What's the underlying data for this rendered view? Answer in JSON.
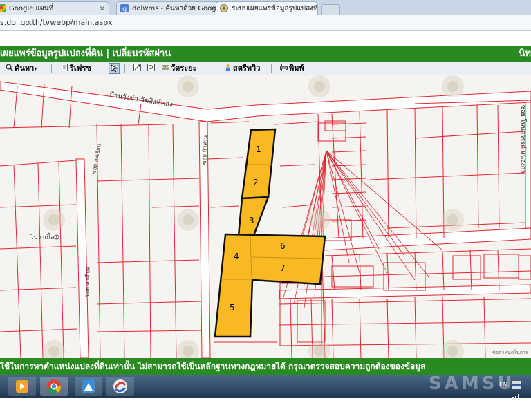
{
  "browser": {
    "tabs": [
      {
        "label": "Google แผนที่",
        "icon": "google-maps-icon"
      },
      {
        "label": "dolwms - ค้นหาด้วย Google",
        "icon": "google-search-icon"
      },
      {
        "label": "ระบบเผยแพร่ข้อมูลรูปแปลงที่",
        "icon": "dol-seal-icon"
      }
    ],
    "close_glyph": "×",
    "url": "s.dol.go.th/tvwebp/main.aspx"
  },
  "header": {
    "title": "เผยแพร่ข้อมูลรูปแปลงที่ดิน | เปลี่ยนรหัสผ่าน",
    "right_text": "นิท"
  },
  "toolbar": {
    "search_label": "ค้นหา",
    "refresh_label": "รีเฟรช",
    "measure_label": "วัดระยะ",
    "streetview_label": "สตรีทวิว",
    "print_label": "พิมพ์"
  },
  "map": {
    "road_label": "บ้านวังข่า-วัดสิงห์ทอง",
    "soi_left": "ซอย ละเอียบ",
    "soi_mid": "ซอย หัวสวน",
    "soi_bottom": "ซอย ลาเอียด",
    "soi_right": "ซอย โนนสวรรค์ หนองกา",
    "place_label": "ไปวาเกิ้ล",
    "copyright": "ข้อคำหนดในการ",
    "parcels": [
      "1",
      "2",
      "3",
      "4",
      "5",
      "6",
      "7"
    ],
    "colors": {
      "parcel_fill": "#f9b922",
      "boundary": "#e0262e",
      "road": "#ffffff"
    }
  },
  "disclaimer": "ใช้ในการหาตำแหน่งแปลงที่ดินเท่านั้น ไม่สามารถใช้เป็นหลักฐานทางกฎหมายได้ กรุณาตรวจสอบความถูกต้องของข้อมูล",
  "taskbar": {
    "lang": "EN",
    "brand_watermark": "SAMSU"
  }
}
